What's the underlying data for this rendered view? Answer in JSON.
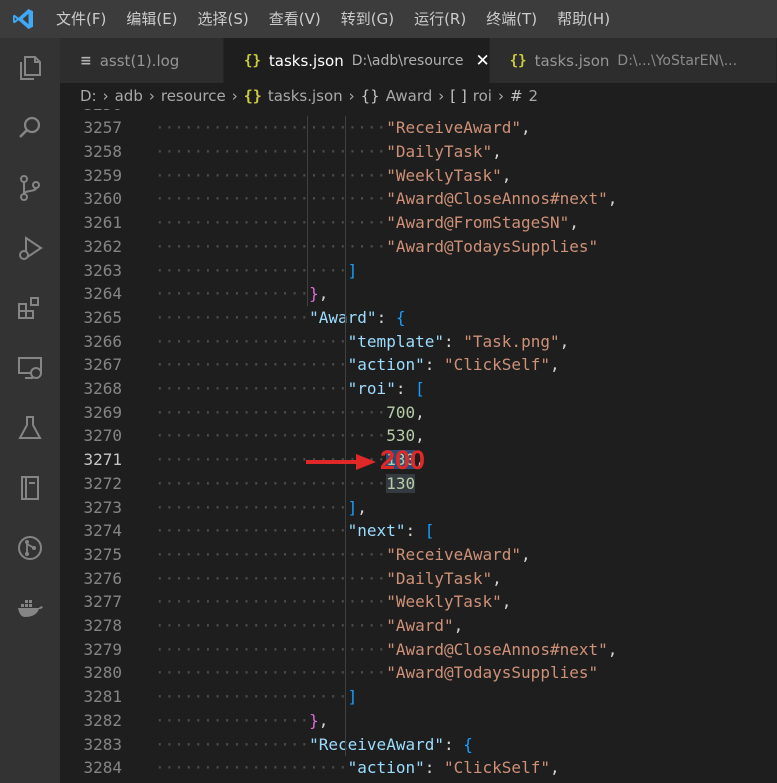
{
  "menu": [
    "文件(F)",
    "编辑(E)",
    "选择(S)",
    "查看(V)",
    "转到(G)",
    "运行(R)",
    "终端(T)",
    "帮助(H)"
  ],
  "tabs": [
    {
      "label": "asst(1).log",
      "desc": "",
      "icon": "log-file-icon"
    },
    {
      "label": "tasks.json",
      "desc": "D:\\adb\\resource",
      "icon": "json-file-icon",
      "active": true,
      "close": "✕"
    },
    {
      "label": "tasks.json",
      "desc": "D:\\...\\YoStarEN\\...",
      "icon": "json-file-icon"
    }
  ],
  "breadcrumb": [
    "D:",
    "adb",
    "resource",
    "tasks.json",
    "Award",
    "roi",
    "2"
  ],
  "breadcrumb_icons": {
    "json": "{}",
    "object": "{}",
    "array": "[ ]",
    "number": "#"
  },
  "editor": {
    "current_line": 3271,
    "lines": [
      {
        "n": "3257",
        "text": "\"ReceiveAward\","
      },
      {
        "n": "3258",
        "text": "\"DailyTask\","
      },
      {
        "n": "3259",
        "text": "\"WeeklyTask\","
      },
      {
        "n": "3260",
        "text": "\"Award@CloseAnnos#next\","
      },
      {
        "n": "3261",
        "text": "\"Award@FromStageSN\","
      },
      {
        "n": "3262",
        "text": "\"Award@TodaysSupplies\""
      },
      {
        "n": "3263",
        "text": "]"
      },
      {
        "n": "3264",
        "text": "},"
      },
      {
        "n": "3265",
        "text": "\"Award\": {"
      },
      {
        "n": "3266",
        "text": "\"template\": \"Task.png\","
      },
      {
        "n": "3267",
        "text": "\"action\": \"ClickSelf\","
      },
      {
        "n": "3268",
        "text": "\"roi\": ["
      },
      {
        "n": "3269",
        "text": "700,"
      },
      {
        "n": "3270",
        "text": "530,"
      },
      {
        "n": "3271",
        "text": "130,"
      },
      {
        "n": "3272",
        "text": "130"
      },
      {
        "n": "3273",
        "text": "],"
      },
      {
        "n": "3274",
        "text": "\"next\": ["
      },
      {
        "n": "3275",
        "text": "\"ReceiveAward\","
      },
      {
        "n": "3276",
        "text": "\"DailyTask\","
      },
      {
        "n": "3277",
        "text": "\"WeeklyTask\","
      },
      {
        "n": "3278",
        "text": "\"Award\","
      },
      {
        "n": "3279",
        "text": "\"Award@CloseAnnos#next\","
      },
      {
        "n": "3280",
        "text": "\"Award@TodaysSupplies\""
      },
      {
        "n": "3281",
        "text": "]"
      },
      {
        "n": "3282",
        "text": "},"
      },
      {
        "n": "3283",
        "text": "\"ReceiveAward\": {"
      },
      {
        "n": "3284",
        "text": "\"action\": \"ClickSelf\","
      }
    ]
  },
  "annotation": {
    "text": "200",
    "color": "#e02828"
  },
  "colors": {
    "accent": "#007acc",
    "key": "#9cdcfe",
    "string": "#ce9178",
    "number": "#b5cea8",
    "selection": "#264f78"
  }
}
